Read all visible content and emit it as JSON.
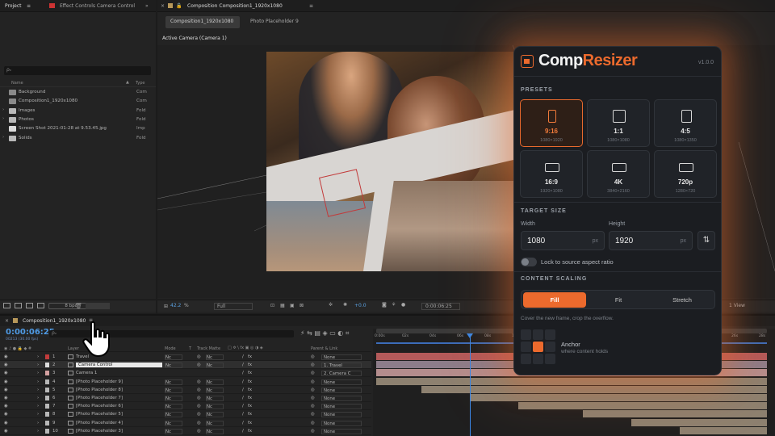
{
  "project": {
    "tab_label": "Project",
    "tab2_label": "Effect Controls Camera Control",
    "search_placeholder": "ρᵥ",
    "col_name": "Name",
    "col_type": "Type",
    "items": [
      {
        "name": "Background",
        "type": "Com",
        "icon": "comp-icon"
      },
      {
        "name": "Composition1_1920x1080",
        "type": "Com",
        "icon": "comp-icon"
      },
      {
        "name": "Images",
        "type": "Fold",
        "icon": "folder-icon"
      },
      {
        "name": "Photos",
        "type": "Fold",
        "icon": "folder-icon"
      },
      {
        "name": "Screen Shot 2021-01-28 at 9.53.45.jpg",
        "type": "Imp",
        "icon": "file-icon"
      },
      {
        "name": "Solids",
        "type": "Fold",
        "icon": "folder-icon"
      }
    ],
    "bpc": "8 bpc"
  },
  "viewer": {
    "tab_label": "Composition Composition1_1920x1080",
    "subtab_active": "Composition1_1920x1080",
    "subtab_other": "Photo Placeholder 9",
    "camera_label": "Active Camera (Camera 1)",
    "zoom": "42.2",
    "zoom_unit": "%",
    "resolution": "Full",
    "exposure": "+0.0",
    "timecode": "0:00:06:25",
    "view_count": "1 View"
  },
  "timeline": {
    "tab_label": "Composition1_1920x1080",
    "timecode": "0:00:06:25",
    "frame_info": "00213 (30.00 fps)",
    "search_placeholder": "ρᵥ",
    "headers": {
      "layer": "Layer",
      "mode": "Mode",
      "t": "T",
      "track_matte": "Track Matte",
      "parent": "Parent & Link"
    },
    "ruler": [
      "0:00s",
      "02s",
      "04s",
      "06s",
      "08s",
      "10s",
      "12s",
      "14s",
      "16s",
      "18s",
      "20s",
      "22s",
      "24s",
      "26s",
      "28s"
    ],
    "layers": [
      {
        "num": "1",
        "name": "Travel",
        "mode": "Nc",
        "matte": "Nc",
        "parent": "None"
      },
      {
        "num": "2",
        "name": "Camera Control",
        "mode": "Nc",
        "matte": "Nc",
        "parent": "1. Travel"
      },
      {
        "num": "3",
        "name": "Camera 1",
        "mode": "",
        "matte": "",
        "parent": "2. Camera C"
      },
      {
        "num": "4",
        "name": "[Photo Placeholder 9]",
        "mode": "Nc",
        "matte": "Nc",
        "parent": "None"
      },
      {
        "num": "5",
        "name": "[Photo Placeholder 8]",
        "mode": "Nc",
        "matte": "Nc",
        "parent": "None"
      },
      {
        "num": "6",
        "name": "[Photo Placeholder 7]",
        "mode": "Nc",
        "matte": "Nc",
        "parent": "None"
      },
      {
        "num": "7",
        "name": "[Photo Placeholder 6]",
        "mode": "Nc",
        "matte": "Nc",
        "parent": "None"
      },
      {
        "num": "8",
        "name": "[Photo Placeholder 5]",
        "mode": "Nc",
        "matte": "Nc",
        "parent": "None"
      },
      {
        "num": "9",
        "name": "[Photo Placeholder 4]",
        "mode": "Nc",
        "matte": "Nc",
        "parent": "None"
      },
      {
        "num": "10",
        "name": "[Photo Placeholder 3]",
        "mode": "Nc",
        "matte": "Nc",
        "parent": "None"
      }
    ]
  },
  "resizer": {
    "brand_left": "Comp",
    "brand_right": "Resizer",
    "version": "v1.0.0",
    "presets_title": "PRESETS",
    "presets": [
      {
        "label": "9:16",
        "sub": "1080×1920"
      },
      {
        "label": "1:1",
        "sub": "1080×1080"
      },
      {
        "label": "4:5",
        "sub": "1080×1350"
      },
      {
        "label": "16:9",
        "sub": "1920×1080"
      },
      {
        "label": "4K",
        "sub": "3840×2160"
      },
      {
        "label": "720p",
        "sub": "1280×720"
      }
    ],
    "target_title": "TARGET SIZE",
    "width_label": "Width",
    "height_label": "Height",
    "width_value": "1080",
    "height_value": "1920",
    "unit": "px",
    "lock_label": "Lock to source aspect ratio",
    "scaling_title": "CONTENT SCALING",
    "scaling_options": [
      "Fill",
      "Fit",
      "Stretch"
    ],
    "scaling_hint": "Cover the new frame, crop the overflow.",
    "anchor_label": "Anchor",
    "anchor_hint": "where content holds",
    "accent": "#ec6a2d"
  }
}
